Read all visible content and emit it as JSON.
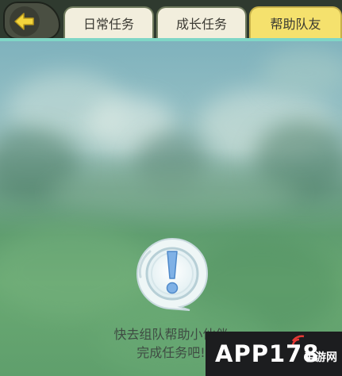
{
  "tabs": [
    {
      "label": "日常任务",
      "active": false
    },
    {
      "label": "成长任务",
      "active": false
    },
    {
      "label": "帮助队友",
      "active": true
    }
  ],
  "back_icon": "back-arrow-icon",
  "notice": {
    "icon": "exclamation-icon",
    "line1": "快去组队帮助小伙伴",
    "line2": "完成任务吧!"
  },
  "watermark": {
    "main": "APP178",
    "sub": "手游网"
  },
  "colors": {
    "active_tab": "#f5e16d",
    "tab": "#f2eedd",
    "topbar": "#2f3a2f",
    "back_arrow": "#f2d43c"
  }
}
